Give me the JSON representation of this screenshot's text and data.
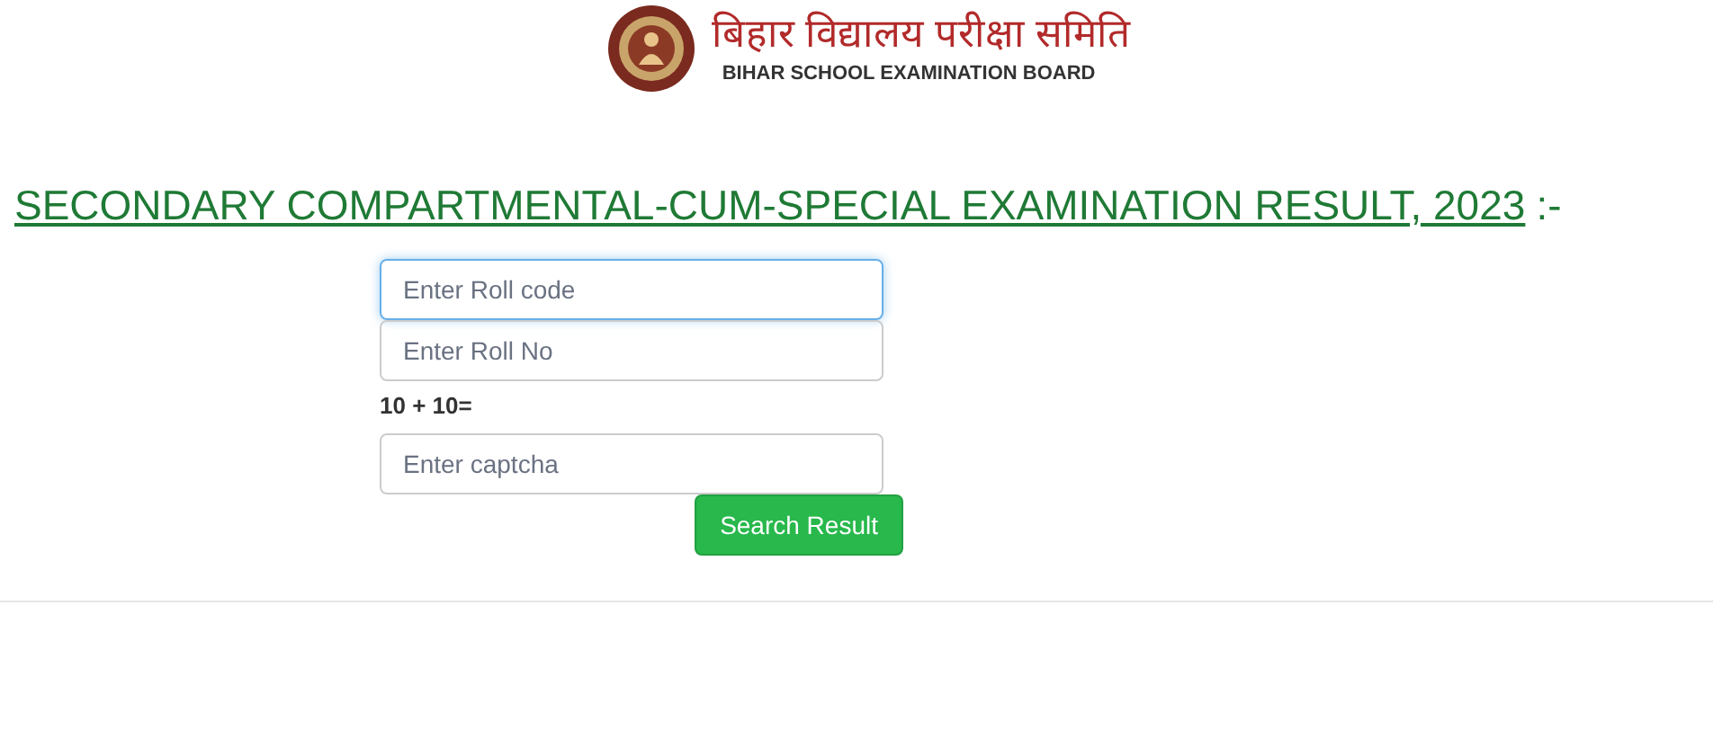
{
  "header": {
    "title_hindi": "बिहार विद्यालय परीक्षा समिति",
    "title_english": "BIHAR SCHOOL EXAMINATION BOARD"
  },
  "heading": {
    "title": "SECONDARY COMPARTMENTAL-CUM-SPECIAL EXAMINATION RESULT, 2023",
    "suffix": ":-"
  },
  "form": {
    "fields": [
      {
        "placeholder": "Enter Roll code",
        "focused": true
      },
      {
        "placeholder": "Enter Roll No",
        "focused": false
      }
    ],
    "captcha_question": "10 + 10=",
    "captcha_field": {
      "placeholder": "Enter captcha",
      "focused": false
    },
    "submit": "Search Result"
  }
}
